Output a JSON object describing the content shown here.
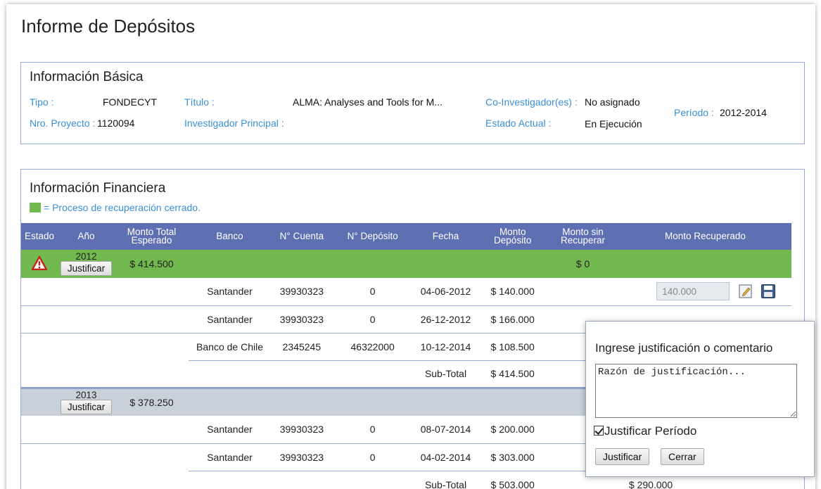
{
  "page": {
    "title": "Informe de Depósitos"
  },
  "basic": {
    "title": "Información Básica",
    "tipo_label": "Tipo :",
    "tipo_value": "FONDECYT",
    "titulo_label": "Título :",
    "titulo_value": "ALMA: Analyses and Tools for M...",
    "coinv_label": "Co-Investigador(es) :",
    "coinv_value": "No asignado",
    "periodo_label": "Período :",
    "periodo_value": "2012-2014",
    "nro_label": "Nro. Proyecto :",
    "nro_value": "1120094",
    "ip_label": "Investigador Principal :",
    "estado_label": "Estado Actual :",
    "estado_value": "En Ejecución"
  },
  "financial": {
    "title": "Información Financiera",
    "legend_text": "= Proceso de recuperación cerrado.",
    "legend_color": "#71b84f",
    "columns": [
      "Estado",
      "Año",
      "Monto Total Esperado",
      "Banco",
      "N° Cuenta",
      "N° Depósito",
      "Fecha",
      "Monto Depósito",
      "Monto sin Recuperar",
      "Monto Recuperado"
    ],
    "justify_label": "Justificar",
    "subtotal_label": "Sub-Total",
    "years": [
      {
        "year": "2012",
        "expected": "$ 414.500",
        "unrecovered": "$ 0",
        "rows": [
          {
            "banco": "Santander",
            "cuenta": "39930323",
            "deposito": "0",
            "fecha": "04-06-2012",
            "monto": "$ 140.000",
            "recuperado": "140.000"
          },
          {
            "banco": "Santander",
            "cuenta": "39930323",
            "deposito": "0",
            "fecha": "26-12-2012",
            "monto": "$ 166.000"
          },
          {
            "banco": "Banco de Chile",
            "cuenta": "2345245",
            "deposito": "46322000",
            "fecha": "10-12-2014",
            "monto": "$ 108.500"
          }
        ],
        "subtotal": "$ 414.500"
      },
      {
        "year": "2013",
        "expected": "$ 378.250",
        "rows": [
          {
            "banco": "Santander",
            "cuenta": "39930323",
            "deposito": "0",
            "fecha": "08-07-2014",
            "monto": "$ 200.000"
          },
          {
            "banco": "Santander",
            "cuenta": "39930323",
            "deposito": "0",
            "fecha": "04-02-2014",
            "monto": "$ 303.000"
          }
        ],
        "subtotal": "$ 503.000",
        "subtotal_recovered": "$ 290.000"
      }
    ]
  },
  "popup": {
    "title": "Ingrese justificación o comentario",
    "placeholder": "Razón de justificación...",
    "checkbox_label": "Justificar Período",
    "justify_button": "Justificar",
    "close_button": "Cerrar"
  }
}
